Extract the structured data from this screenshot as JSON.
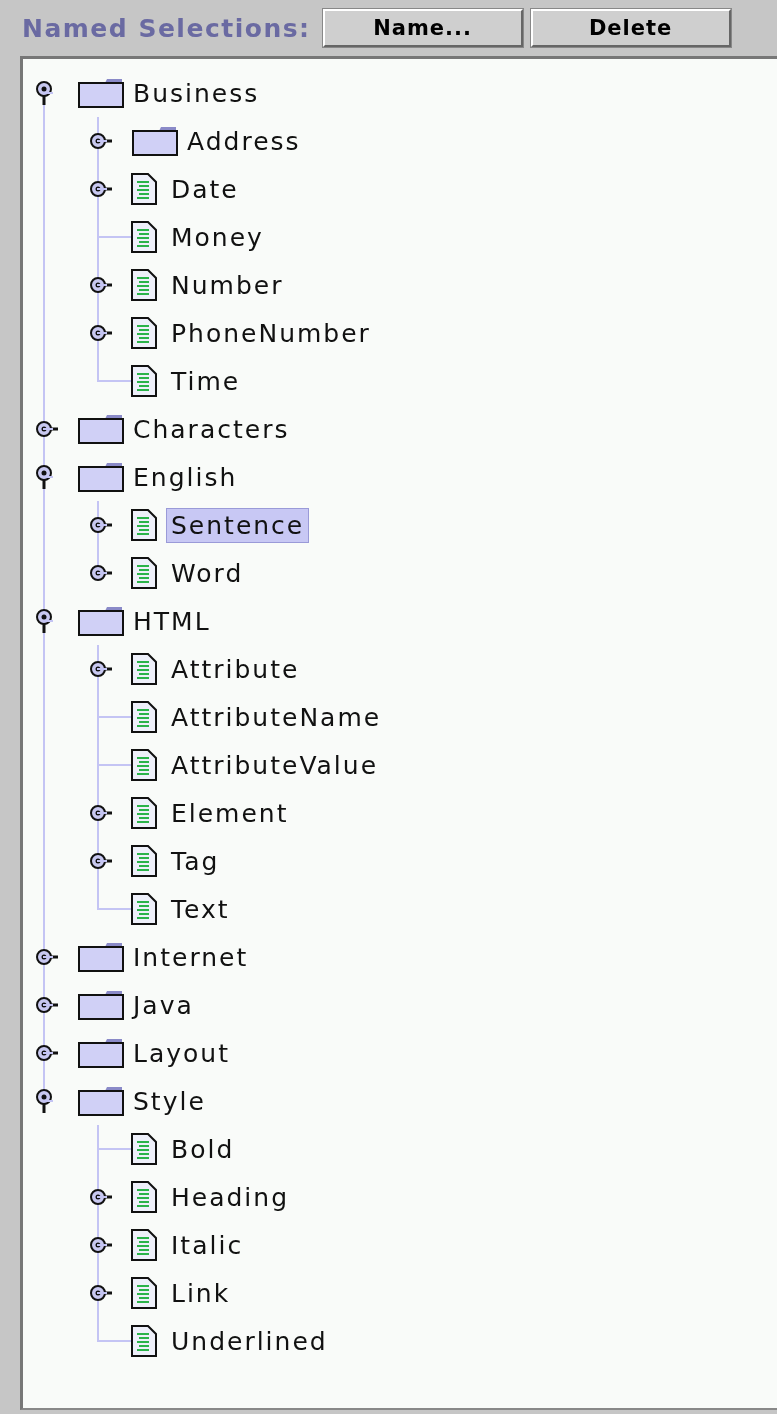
{
  "header": {
    "label": "Named Selections:",
    "buttons": [
      "Name...",
      "Delete"
    ]
  },
  "tree": [
    {
      "label": "Business",
      "kind": "folder",
      "expanded": true,
      "selected": false,
      "children": [
        {
          "label": "Address",
          "kind": "folder",
          "expanded": false,
          "selected": false
        },
        {
          "label": "Date",
          "kind": "file",
          "expanded": false,
          "selected": false
        },
        {
          "label": "Money",
          "kind": "file",
          "selected": false
        },
        {
          "label": "Number",
          "kind": "file",
          "expanded": false,
          "selected": false
        },
        {
          "label": "PhoneNumber",
          "kind": "file",
          "expanded": false,
          "selected": false
        },
        {
          "label": "Time",
          "kind": "file",
          "selected": false
        }
      ]
    },
    {
      "label": "Characters",
      "kind": "folder",
      "expanded": false,
      "selected": false
    },
    {
      "label": "English",
      "kind": "folder",
      "expanded": true,
      "selected": false,
      "children": [
        {
          "label": "Sentence",
          "kind": "file",
          "expanded": false,
          "selected": true
        },
        {
          "label": "Word",
          "kind": "file",
          "expanded": false,
          "selected": false
        }
      ]
    },
    {
      "label": "HTML",
      "kind": "folder",
      "expanded": true,
      "selected": false,
      "children": [
        {
          "label": "Attribute",
          "kind": "file",
          "expanded": false,
          "selected": false
        },
        {
          "label": "AttributeName",
          "kind": "file",
          "selected": false
        },
        {
          "label": "AttributeValue",
          "kind": "file",
          "selected": false
        },
        {
          "label": "Element",
          "kind": "file",
          "expanded": false,
          "selected": false
        },
        {
          "label": "Tag",
          "kind": "file",
          "expanded": false,
          "selected": false
        },
        {
          "label": "Text",
          "kind": "file",
          "selected": false
        }
      ]
    },
    {
      "label": "Internet",
      "kind": "folder",
      "expanded": false,
      "selected": false
    },
    {
      "label": "Java",
      "kind": "folder",
      "expanded": false,
      "selected": false
    },
    {
      "label": "Layout",
      "kind": "folder",
      "expanded": false,
      "selected": false
    },
    {
      "label": "Style",
      "kind": "folder",
      "expanded": true,
      "selected": false,
      "children": [
        {
          "label": "Bold",
          "kind": "file",
          "selected": false
        },
        {
          "label": "Heading",
          "kind": "file",
          "expanded": false,
          "selected": false
        },
        {
          "label": "Italic",
          "kind": "file",
          "expanded": false,
          "selected": false
        },
        {
          "label": "Link",
          "kind": "file",
          "expanded": false,
          "selected": false
        },
        {
          "label": "Underlined",
          "kind": "file",
          "selected": false
        }
      ]
    }
  ]
}
